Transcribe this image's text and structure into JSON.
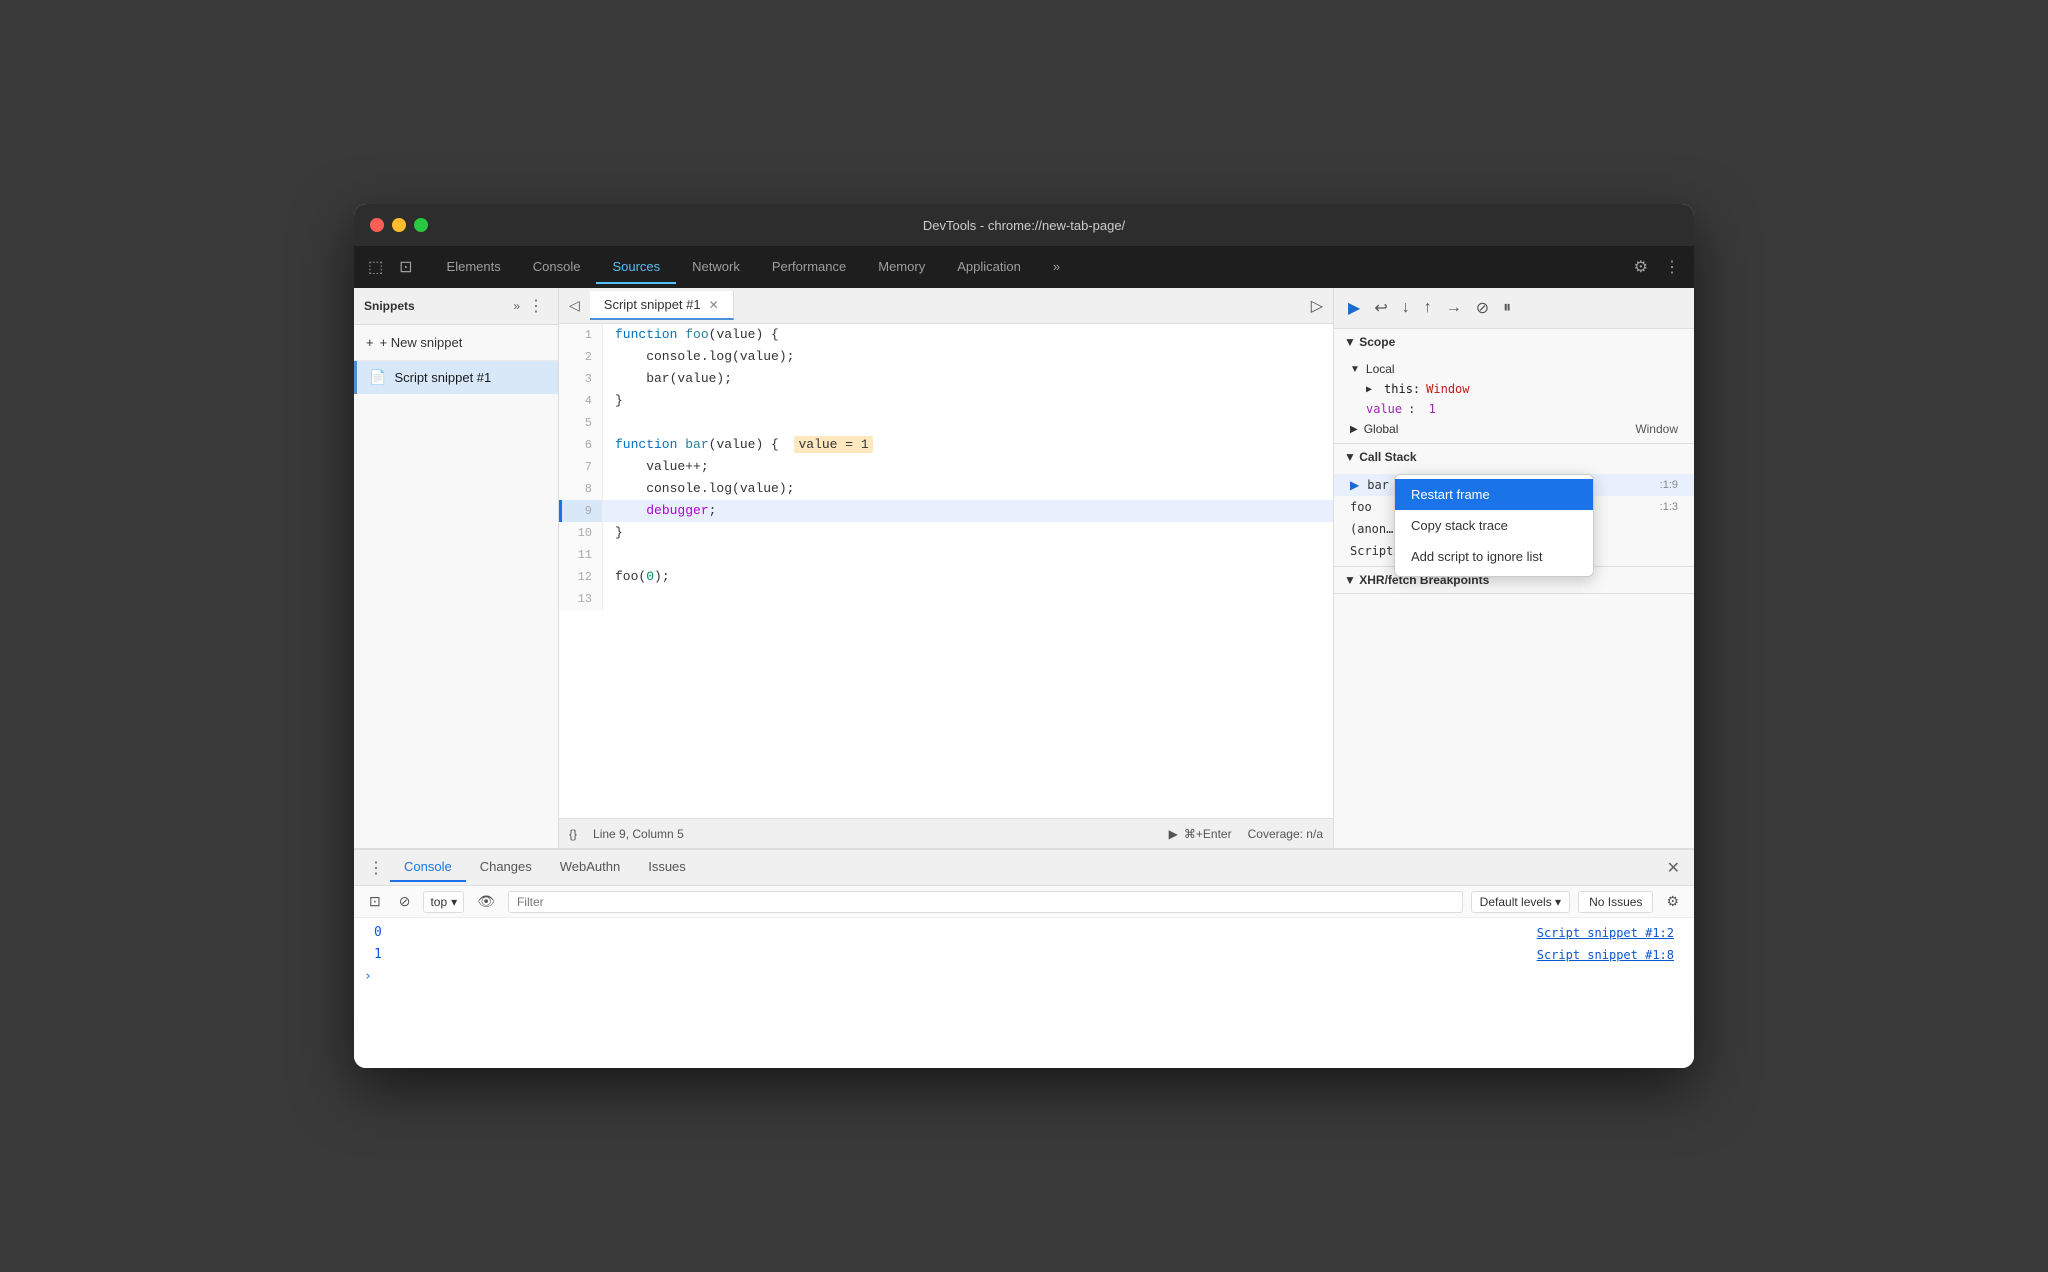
{
  "window": {
    "title": "DevTools - chrome://new-tab-page/"
  },
  "tabs": {
    "items": [
      "Elements",
      "Console",
      "Sources",
      "Network",
      "Performance",
      "Memory",
      "Application"
    ],
    "active": "Sources",
    "more_icon": "»"
  },
  "left_panel": {
    "label": "Snippets",
    "more": "»",
    "dots": "⋮",
    "new_snippet": "+ New snippet",
    "snippet_name": "Script snippet #1"
  },
  "editor": {
    "tab_name": "Script snippet #1",
    "lines": [
      {
        "num": 1,
        "content": "function foo(value) {"
      },
      {
        "num": 2,
        "content": "    console.log(value);"
      },
      {
        "num": 3,
        "content": "    bar(value);"
      },
      {
        "num": 4,
        "content": "}"
      },
      {
        "num": 5,
        "content": ""
      },
      {
        "num": 6,
        "content": "function bar(value) {"
      },
      {
        "num": 7,
        "content": "    value++;"
      },
      {
        "num": 8,
        "content": "    console.log(value);"
      },
      {
        "num": 9,
        "content": "    debugger;",
        "highlighted": true
      },
      {
        "num": 10,
        "content": "}"
      },
      {
        "num": 11,
        "content": ""
      },
      {
        "num": 12,
        "content": "foo(0);"
      },
      {
        "num": 13,
        "content": ""
      }
    ],
    "status": {
      "line_col": "Line 9, Column 5",
      "run_label": "⌘+Enter",
      "coverage": "Coverage: n/a"
    }
  },
  "right_panel": {
    "debugger_toolbar": {
      "resume": "▶",
      "step_over": "↩",
      "step_into": "↓",
      "step_out": "↑",
      "step": "→",
      "deactivate": "⊘",
      "pause": "⏸"
    },
    "scope": {
      "title": "▼ Scope",
      "local": {
        "label": "▼ Local",
        "items": [
          {
            "key": "▶ this",
            "val": "Window"
          },
          {
            "key": "value",
            "val": "1",
            "purple": true
          }
        ]
      },
      "global": {
        "label": "▶ Global",
        "val": "Window"
      }
    },
    "call_stack": {
      "title": "▼ Call Stack",
      "items": [
        {
          "name": "bar",
          "loc": ":1:9",
          "active": true
        },
        {
          "name": "foo",
          "loc": ":1:3"
        },
        {
          "name": "(anon…",
          "loc": ""
        },
        {
          "name": "Script snippet #1:12",
          "loc": ""
        }
      ]
    }
  },
  "context_menu": {
    "items": [
      {
        "label": "Restart frame",
        "selected": true
      },
      {
        "label": "Copy stack trace"
      },
      {
        "label": "Add script to ignore list"
      }
    ]
  },
  "bottom_panel": {
    "tabs": [
      "Console",
      "Changes",
      "WebAuthn",
      "Issues"
    ],
    "active_tab": "Console",
    "console": {
      "top_label": "top",
      "filter_placeholder": "Filter",
      "levels_label": "Default levels ▾",
      "issues_label": "No Issues",
      "log_lines": [
        {
          "value": "0",
          "src": "Script snippet #1:2"
        },
        {
          "value": "1",
          "src": "Script snippet #1:8"
        }
      ],
      "prompt": ">"
    }
  }
}
